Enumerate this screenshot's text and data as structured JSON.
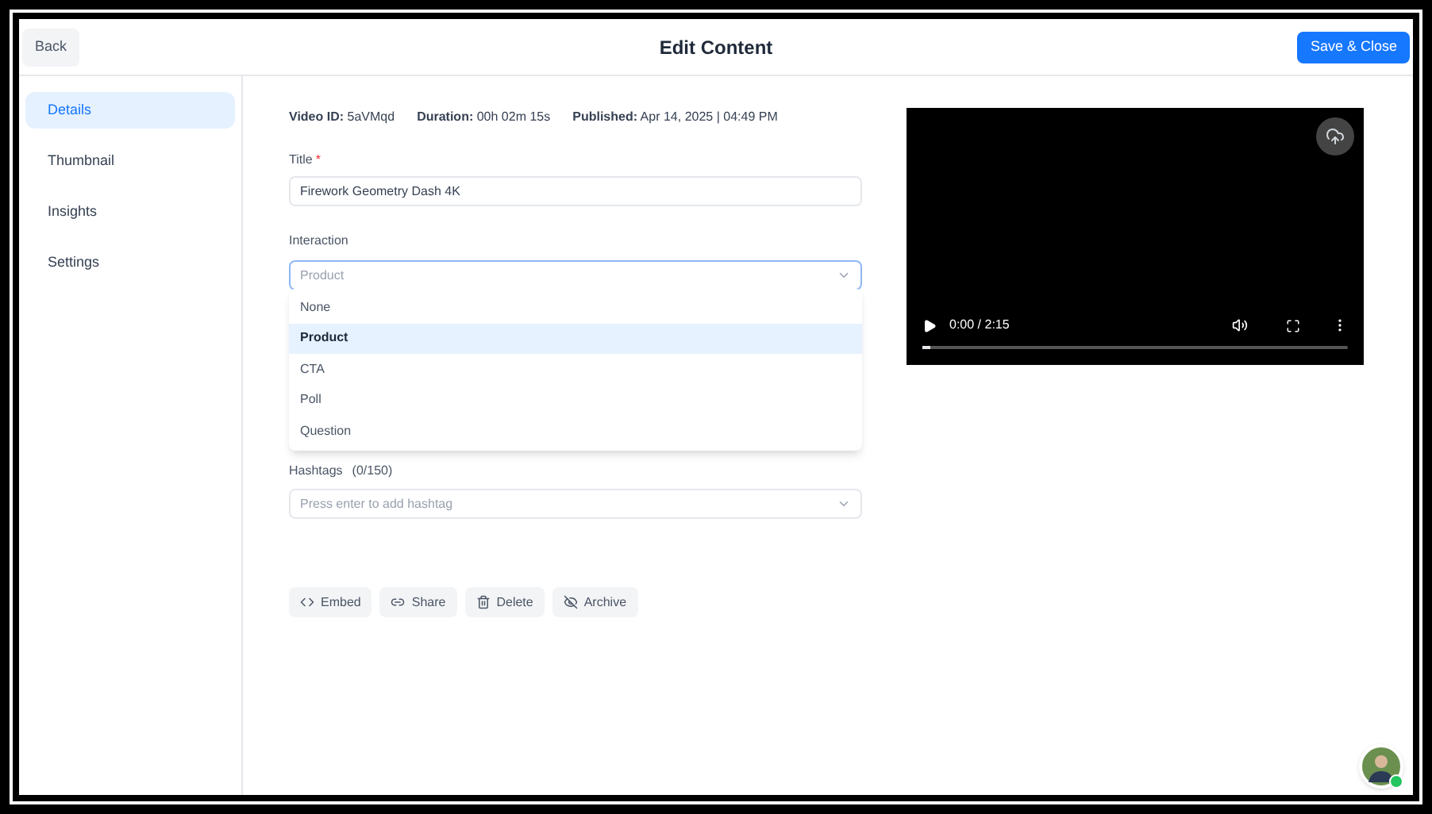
{
  "header": {
    "back": "Back",
    "title": "Edit Content",
    "save": "Save & Close"
  },
  "sidebar": {
    "items": [
      {
        "label": "Details",
        "selected": true
      },
      {
        "label": "Thumbnail",
        "selected": false
      },
      {
        "label": "Insights",
        "selected": false
      },
      {
        "label": "Settings",
        "selected": false
      }
    ]
  },
  "meta": [
    {
      "label": "Video ID:",
      "value": "5aVMqd"
    },
    {
      "label": "Duration:",
      "value": "00h 02m 15s"
    },
    {
      "label": "Published:",
      "value": "Apr 14, 2025 | 04:49 PM"
    }
  ],
  "title_field": {
    "label": "Title",
    "required_mark": "*",
    "value": "Firework Geometry Dash 4K"
  },
  "interaction": {
    "label": "Interaction",
    "placeholder": "Product",
    "expanded": true,
    "options": [
      {
        "label": "None",
        "selected": false
      },
      {
        "label": "Product",
        "selected": true
      },
      {
        "label": "CTA",
        "selected": false
      },
      {
        "label": "Poll",
        "selected": false
      },
      {
        "label": "Question",
        "selected": false
      }
    ]
  },
  "hashtags": {
    "label": "Hashtags",
    "count": "(0/150)",
    "placeholder": "Press enter to add hashtag"
  },
  "actions": [
    {
      "kind": "embed",
      "label": "Embed"
    },
    {
      "kind": "share",
      "label": "Share"
    },
    {
      "kind": "delete",
      "label": "Delete"
    },
    {
      "kind": "archive",
      "label": "Archive"
    }
  ],
  "video": {
    "time": "0:00 / 2:15",
    "level": 0.02
  }
}
